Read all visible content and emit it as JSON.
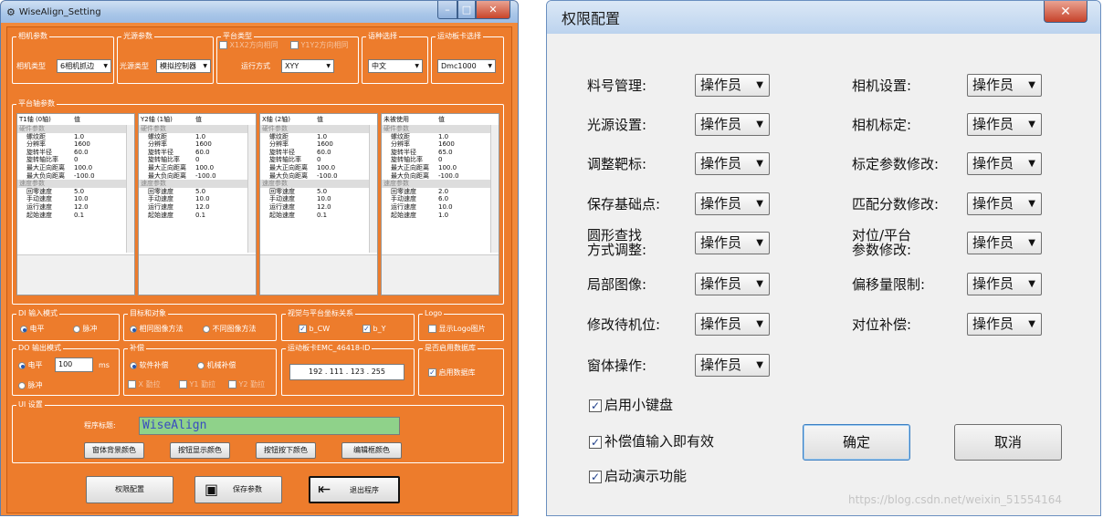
{
  "left": {
    "title": "WiseAlign_Setting",
    "camera": {
      "group": "相机参数",
      "label": "相机类型",
      "value": "6相机抓边"
    },
    "light": {
      "group": "光源参数",
      "label": "光源类型",
      "value": "模拟控制器"
    },
    "platform": {
      "group": "平台类型",
      "opt1": "X1X2方向相同",
      "opt2": "Y1Y2方向相同",
      "label": "运行方式",
      "value": "XYY"
    },
    "language": {
      "group": "语种选择",
      "value": "中文"
    },
    "board": {
      "group": "运动板卡选择",
      "value": "Dmc1000"
    },
    "axes_group": "平台轴参数",
    "grids": [
      {
        "h1": "T1轴 (0轴)",
        "h2": "值",
        "cat1": "硬件参数",
        "cat2": "速度参数",
        "hw": [
          [
            "螺纹距",
            "1.0"
          ],
          [
            "分辨率",
            "1600"
          ],
          [
            "旋转半径",
            "60.0"
          ],
          [
            "旋转轴比率",
            "0"
          ],
          [
            "最大正向距离",
            "100.0"
          ],
          [
            "最大负向距离",
            "-100.0"
          ]
        ],
        "sp": [
          [
            "回零速度",
            "5.0"
          ],
          [
            "手动速度",
            "10.0"
          ],
          [
            "运行速度",
            "12.0"
          ],
          [
            "起始速度",
            "0.1"
          ]
        ]
      },
      {
        "h1": "Y2轴 (1轴)",
        "h2": "值",
        "cat1": "硬件参数",
        "cat2": "速度参数",
        "hw": [
          [
            "螺纹距",
            "1.0"
          ],
          [
            "分辨率",
            "1600"
          ],
          [
            "旋转半径",
            "60.0"
          ],
          [
            "旋转轴比率",
            "0"
          ],
          [
            "最大正向距离",
            "100.0"
          ],
          [
            "最大负向距离",
            "-100.0"
          ]
        ],
        "sp": [
          [
            "回零速度",
            "5.0"
          ],
          [
            "手动速度",
            "10.0"
          ],
          [
            "运行速度",
            "12.0"
          ],
          [
            "起始速度",
            "0.1"
          ]
        ]
      },
      {
        "h1": "X轴 (2轴)",
        "h2": "值",
        "cat1": "硬件参数",
        "cat2": "速度参数",
        "hw": [
          [
            "螺纹距",
            "1.0"
          ],
          [
            "分辨率",
            "1600"
          ],
          [
            "旋转半径",
            "60.0"
          ],
          [
            "旋转轴比率",
            "0"
          ],
          [
            "最大正向距离",
            "100.0"
          ],
          [
            "最大负向距离",
            "-100.0"
          ]
        ],
        "sp": [
          [
            "回零速度",
            "5.0"
          ],
          [
            "手动速度",
            "10.0"
          ],
          [
            "运行速度",
            "12.0"
          ],
          [
            "起始速度",
            "0.1"
          ]
        ]
      },
      {
        "h1": "未被使用",
        "h2": "值",
        "cat1": "硬件参数",
        "cat2": "速度参数",
        "hw": [
          [
            "螺纹距",
            "1.0"
          ],
          [
            "分辨率",
            "1600"
          ],
          [
            "旋转半径",
            "65.0"
          ],
          [
            "旋转轴比率",
            "0"
          ],
          [
            "最大正向距离",
            "100.0"
          ],
          [
            "最大负向距离",
            "-100.0"
          ]
        ],
        "sp": [
          [
            "回零速度",
            "2.0"
          ],
          [
            "手动速度",
            "6.0"
          ],
          [
            "运行速度",
            "10.0"
          ],
          [
            "起始速度",
            "1.0"
          ]
        ]
      }
    ],
    "di": {
      "group": "DI 输入模式",
      "opt1": "电平",
      "opt2": "脉冲"
    },
    "target": {
      "group": "目标和对象",
      "opt1": "相同图像方法",
      "opt2": "不同图像方法"
    },
    "vision": {
      "group": "视觉与平台坐标关系",
      "opt1": "b_CW",
      "opt2": "b_Y"
    },
    "logo": {
      "group": "Logo",
      "opt": "显示Logo图片"
    },
    "do": {
      "group": "DO 输出模式",
      "opt1": "电平",
      "value": "100",
      "unit": "ms",
      "opt2": "脉冲"
    },
    "comp": {
      "group": "补偿",
      "opt1": "软件补偿",
      "opt2": "机械补偿",
      "c1": "X 勤拉",
      "c2": "Y1 勤拉",
      "c3": "Y2 勤拉"
    },
    "ip": {
      "group": "运动板卡EMC_46418-ID",
      "value": "192 . 111 . 123 . 255"
    },
    "db": {
      "group": "是否启用数据库",
      "opt": "启用数据库"
    },
    "ui": {
      "group": "UI 设置",
      "label": "程序标题:",
      "value": "WiseAlign",
      "b1": "窗体背景颜色",
      "b2": "按钮显示颜色",
      "b3": "按钮按下颜色",
      "b4": "编辑框颜色"
    },
    "bottom": {
      "b1": "权限配置",
      "b2": "保存参数",
      "b3": "退出程序"
    }
  },
  "right": {
    "title": "权限配置",
    "rows_left": [
      {
        "label": "料号管理:",
        "value": "操作员"
      },
      {
        "label": "光源设置:",
        "value": "操作员"
      },
      {
        "label": "调整靶标:",
        "value": "操作员"
      },
      {
        "label": "保存基础点:",
        "value": "操作员"
      },
      {
        "label": "圆形查找\n方式调整:",
        "value": "操作员"
      },
      {
        "label": "局部图像:",
        "value": "操作员"
      },
      {
        "label": "修改待机位:",
        "value": "操作员"
      },
      {
        "label": "窗体操作:",
        "value": "操作员"
      }
    ],
    "rows_right": [
      {
        "label": "相机设置:",
        "value": "操作员"
      },
      {
        "label": "相机标定:",
        "value": "操作员"
      },
      {
        "label": "标定参数修改:",
        "value": "操作员"
      },
      {
        "label": "匹配分数修改:",
        "value": "操作员"
      },
      {
        "label": "对位/平台\n参数修改:",
        "value": "操作员"
      },
      {
        "label": "偏移量限制:",
        "value": "操作员"
      },
      {
        "label": "对位补偿:",
        "value": "操作员"
      }
    ],
    "checks": [
      "启用小键盘",
      "补偿值输入即有效",
      "启动演示功能"
    ],
    "ok": "确定",
    "cancel": "取消",
    "watermark": "https://blog.csdn.net/weixin_51554164"
  }
}
